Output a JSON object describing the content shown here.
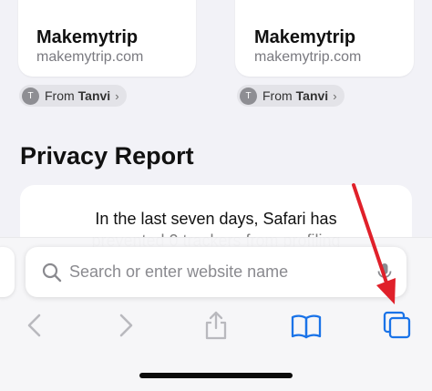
{
  "shared_cards": [
    {
      "title": "Makemytrip",
      "url": "makemytrip.com",
      "from_label": "From",
      "from_name": "Tanvi",
      "avatar_initial": "T"
    },
    {
      "title": "Makemytrip",
      "url": "makemytrip.com",
      "from_label": "From",
      "from_name": "Tanvi",
      "avatar_initial": "T"
    }
  ],
  "privacy_report": {
    "title": "Privacy Report",
    "text_line1": "In the last seven days, Safari has",
    "text_line2": "prevented 0 trackers from profiling"
  },
  "address_bar": {
    "placeholder": "Search or enter website name"
  },
  "toolbar": {
    "buttons": [
      "back",
      "forward",
      "share",
      "bookmarks",
      "tabs"
    ]
  },
  "colors": {
    "accent": "#1a73e8",
    "annotation_arrow": "#e0202a",
    "disabled_icon": "#b9b9be"
  }
}
